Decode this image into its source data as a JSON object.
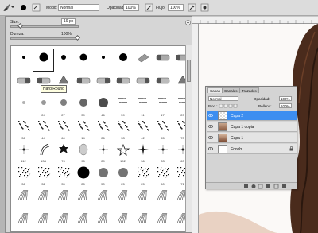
{
  "options_bar": {
    "mode_label": "Modo:",
    "mode_value": "Normal",
    "opacity_label": "Opacidad:",
    "opacity_value": "100%",
    "flow_label": "Flujo:",
    "flow_value": "100%"
  },
  "brush_picker": {
    "size_label": "Size:",
    "size_value": "19 px",
    "hardness_label": "Dureza:",
    "hardness_value": "100%",
    "tooltip": "Hard Round",
    "rows": [
      [
        "",
        "",
        "",
        "",
        "",
        "",
        "",
        "",
        ""
      ],
      [
        "",
        "",
        "",
        "",
        "",
        "",
        "",
        "",
        ""
      ],
      [
        "",
        "24",
        "27",
        "39",
        "46",
        "59",
        "11",
        "17",
        "23"
      ],
      [
        "36",
        "44",
        "60",
        "14",
        "26",
        "33",
        "42",
        "55",
        "70"
      ],
      [
        "112",
        "134",
        "74",
        "95",
        "29",
        "192",
        "36",
        "33",
        "63"
      ],
      [
        "36",
        "32",
        "35",
        "25",
        "50",
        "25",
        "25",
        "50",
        "71"
      ],
      [
        "",
        "",
        "",
        "",
        "",
        "",
        "",
        "",
        ""
      ],
      [
        "",
        "",
        "",
        "",
        "",
        "",
        "",
        "",
        ""
      ]
    ]
  },
  "layers_panel": {
    "tabs": [
      "Capas",
      "Canales",
      "Trazados"
    ],
    "blend_mode": "Normal",
    "opacity_label": "Opacidad:",
    "opacity_value": "100%",
    "lock_label": "Bloq.:",
    "fill_label": "Relleno:",
    "fill_value": "100%",
    "layers": [
      {
        "name": "Capa 2",
        "selected": true
      },
      {
        "name": "Capa 1 copia",
        "selected": false
      },
      {
        "name": "Capa 1",
        "selected": false
      },
      {
        "name": "Fondo",
        "selected": false
      }
    ]
  },
  "colors": {
    "selection": "#3d8ef0",
    "panel_bg": "#d6d6d6"
  }
}
